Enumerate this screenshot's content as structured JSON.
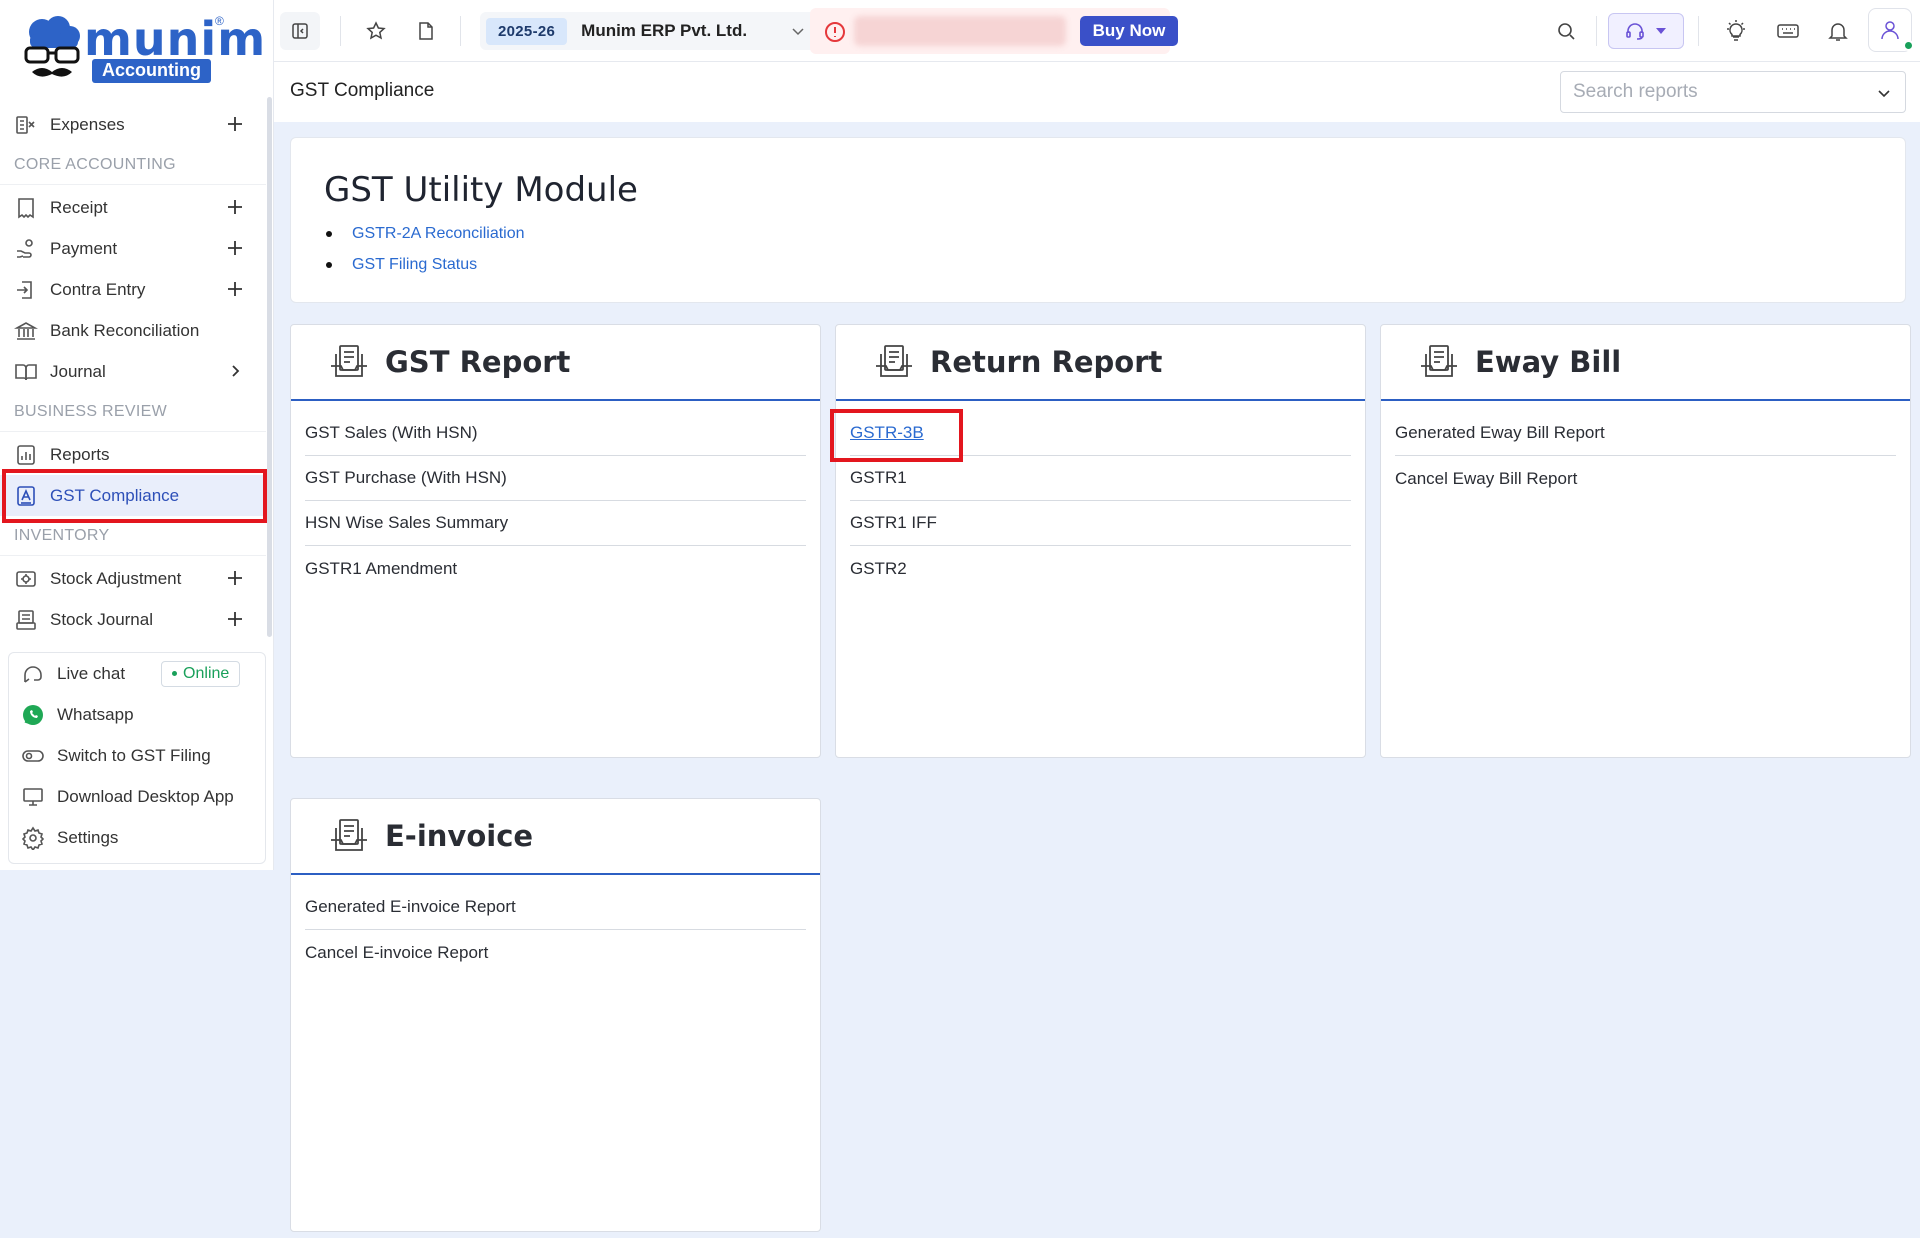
{
  "brand": {
    "name": "munim",
    "badge": "Accounting",
    "registered": "®",
    "color": "#2d63c7"
  },
  "sidebar": {
    "items_top": [
      {
        "label": "Expenses",
        "icon": "expenses-icon",
        "action": "plus"
      }
    ],
    "section_core": "CORE ACCOUNTING",
    "items_core": [
      {
        "label": "Receipt",
        "icon": "receipt-icon",
        "action": "plus"
      },
      {
        "label": "Payment",
        "icon": "payment-icon",
        "action": "plus"
      },
      {
        "label": "Contra Entry",
        "icon": "contra-icon",
        "action": "plus"
      },
      {
        "label": "Bank Reconciliation",
        "icon": "bank-icon",
        "action": ""
      },
      {
        "label": "Journal",
        "icon": "journal-icon",
        "action": "chevron"
      }
    ],
    "section_review": "BUSINESS REVIEW",
    "items_review": [
      {
        "label": "Reports",
        "icon": "reports-icon",
        "action": ""
      },
      {
        "label": "GST Compliance",
        "icon": "gst-compliance-icon",
        "action": "",
        "active": true
      }
    ],
    "section_inventory": "INVENTORY",
    "items_inventory": [
      {
        "label": "Stock Adjustment",
        "icon": "stock-adjustment-icon",
        "action": "plus"
      },
      {
        "label": "Stock Journal",
        "icon": "stock-journal-icon",
        "action": "plus"
      }
    ],
    "help": [
      {
        "label": "Live chat",
        "icon": "live-chat-icon",
        "badge": "Online"
      },
      {
        "label": "Whatsapp",
        "icon": "whatsapp-icon"
      },
      {
        "label": "Switch to GST Filing",
        "icon": "toggle-icon"
      },
      {
        "label": "Download Desktop App",
        "icon": "desktop-icon"
      },
      {
        "label": "Settings",
        "icon": "settings-icon"
      }
    ]
  },
  "topbar": {
    "financial_year": "2025-26",
    "company_name": "Munim ERP Pvt. Ltd.",
    "buy_now": "Buy Now"
  },
  "page": {
    "title": "GST Compliance",
    "search_placeholder": "Search reports"
  },
  "utility": {
    "title": "GST Utility Module",
    "links": [
      "GSTR-2A Reconciliation",
      "GST Filing Status"
    ]
  },
  "cards": [
    {
      "title": "GST Report",
      "items": [
        "GST Sales (With HSN)",
        "GST Purchase (With HSN)",
        "HSN Wise Sales Summary",
        "GSTR1 Amendment"
      ]
    },
    {
      "title": "Return Report",
      "items": [
        "GSTR-3B",
        "GSTR1",
        "GSTR1 IFF",
        "GSTR2"
      ]
    },
    {
      "title": "Eway Bill",
      "items": [
        "Generated Eway Bill Report",
        "Cancel Eway Bill Report"
      ]
    },
    {
      "title": "E-invoice",
      "items": [
        "Generated E-invoice Report",
        "Cancel E-invoice Report"
      ]
    }
  ],
  "colors": {
    "accent": "#2c5fc3",
    "link": "#2a6ad0",
    "highlight": "#e3161e",
    "online": "#19a05a",
    "background": "#eaf0fb"
  }
}
